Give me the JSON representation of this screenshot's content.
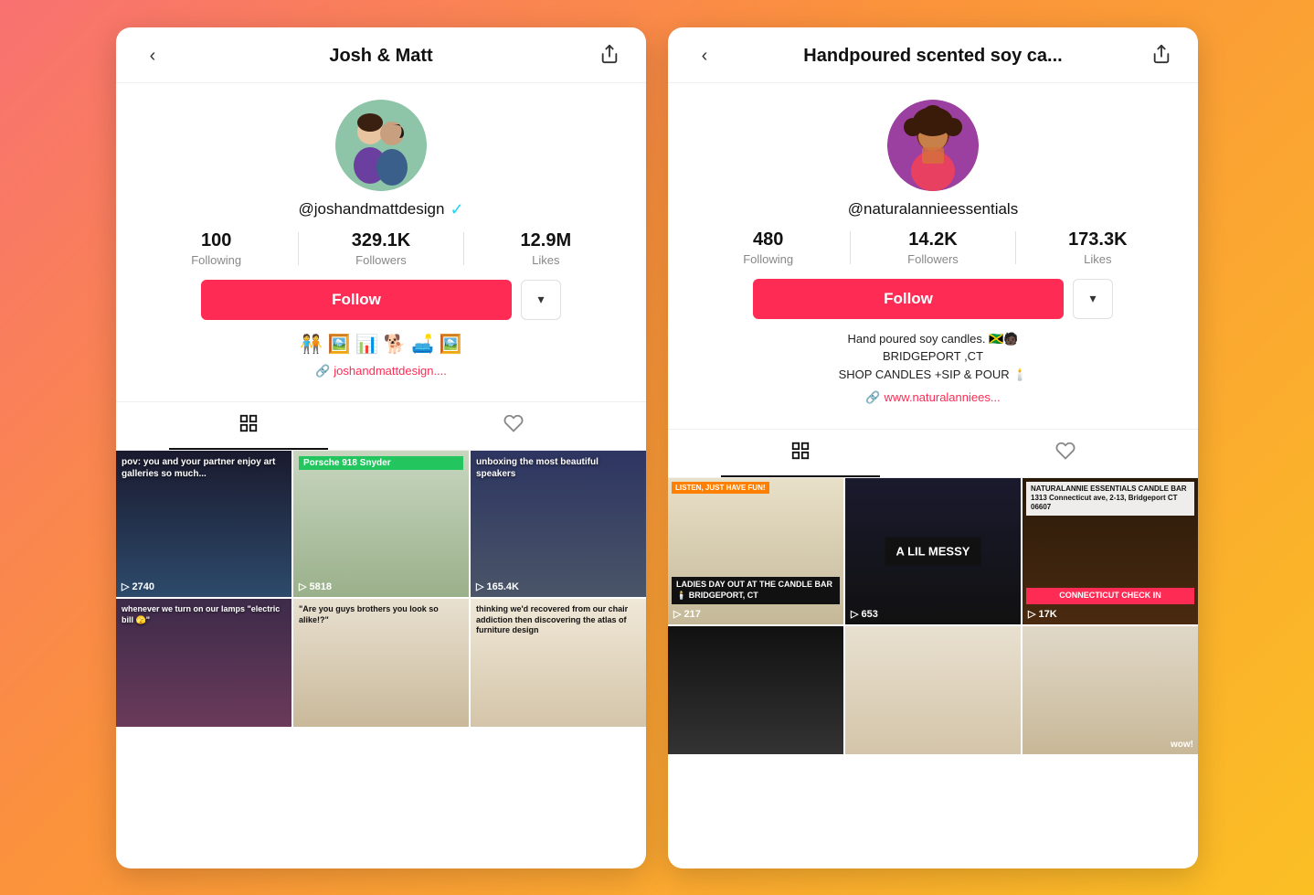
{
  "left_profile": {
    "header_title": "Josh & Matt",
    "back_icon": "‹",
    "share_icon": "↗",
    "username": "@joshandmattdesign",
    "verified": true,
    "stats": [
      {
        "value": "100",
        "label": "Following"
      },
      {
        "value": "329.1K",
        "label": "Followers"
      },
      {
        "value": "12.9M",
        "label": "Likes"
      }
    ],
    "follow_label": "Follow",
    "emoji_bio": "🧑‍🤝‍🧑 🖼️ 📊 🐕 🛋️ 🖼️",
    "link": "joshandmattdesign....",
    "videos": [
      {
        "id": "v1",
        "color_class": "vt1",
        "overlay": "pov: you and your partner enjoy art galleries so much...",
        "count": "2740",
        "has_play": true
      },
      {
        "id": "v2",
        "color_class": "vt2",
        "label": "Porsche 918 Snyder",
        "count": "5818",
        "has_play": true
      },
      {
        "id": "v3",
        "color_class": "vt3",
        "overlay": "unboxing the most beautiful speakers",
        "count": "165.4K",
        "has_play": true
      },
      {
        "id": "v4",
        "color_class": "vt4",
        "overlay": "whenever we turn on our lamps \"electric bill 🫣\"",
        "count": "",
        "has_play": false
      },
      {
        "id": "v5",
        "color_class": "vt5",
        "overlay": "\"Are you guys brothers you look so alike!?\"",
        "count": "",
        "has_play": false
      },
      {
        "id": "v6",
        "color_class": "vt6",
        "overlay": "thinking we'd recovered from our chair addiction then discovering the atlas of furniture design",
        "count": "",
        "has_play": false
      }
    ]
  },
  "right_profile": {
    "header_title": "Handpoured scented soy ca...",
    "back_icon": "‹",
    "share_icon": "↗",
    "username": "@naturalannieessentials",
    "verified": false,
    "stats": [
      {
        "value": "480",
        "label": "Following"
      },
      {
        "value": "14.2K",
        "label": "Followers"
      },
      {
        "value": "173.3K",
        "label": "Likes"
      }
    ],
    "follow_label": "Follow",
    "bio_lines": [
      "Hand poured soy candles. 🇯🇲🧑🏿",
      "BRIDGEPORT ,CT",
      "SHOP CANDLES +SIP & POUR 🕯️"
    ],
    "link": "www.naturalanniees...",
    "videos": [
      {
        "id": "r1",
        "color_class": "vt7",
        "badge": "LISTEN, JUST HAVE FUN!",
        "badge_class": "tag-badge-orange",
        "box_text": "LADIES DAY OUT AT THE CANDLE BAR 🕯️ BRIDGEPORT, CT",
        "box_type": "black",
        "count": "217"
      },
      {
        "id": "r2",
        "color_class": "vt8",
        "box_text": "A LIL MESSY",
        "box_type": "black-center",
        "count": "653"
      },
      {
        "id": "r3",
        "color_class": "vt9",
        "white_box": "NATURALANNIE ESSENTIALS CANDLE BAR\n1313 Connecticut ave, 2-13,\nBridgeport CT 06607",
        "box_text": "CONNECTICUT CHECK IN",
        "box_type": "red",
        "count": "17K"
      },
      {
        "id": "r4",
        "color_class": "vt10",
        "count": ""
      },
      {
        "id": "r5",
        "color_class": "vt11",
        "count": ""
      },
      {
        "id": "r6",
        "color_class": "vt12",
        "count": ""
      }
    ]
  },
  "icons": {
    "grid": "⊞",
    "heart": "♡",
    "heart_filled": "♥",
    "play": "▷",
    "link": "🔗",
    "chevron_down": "▾"
  }
}
